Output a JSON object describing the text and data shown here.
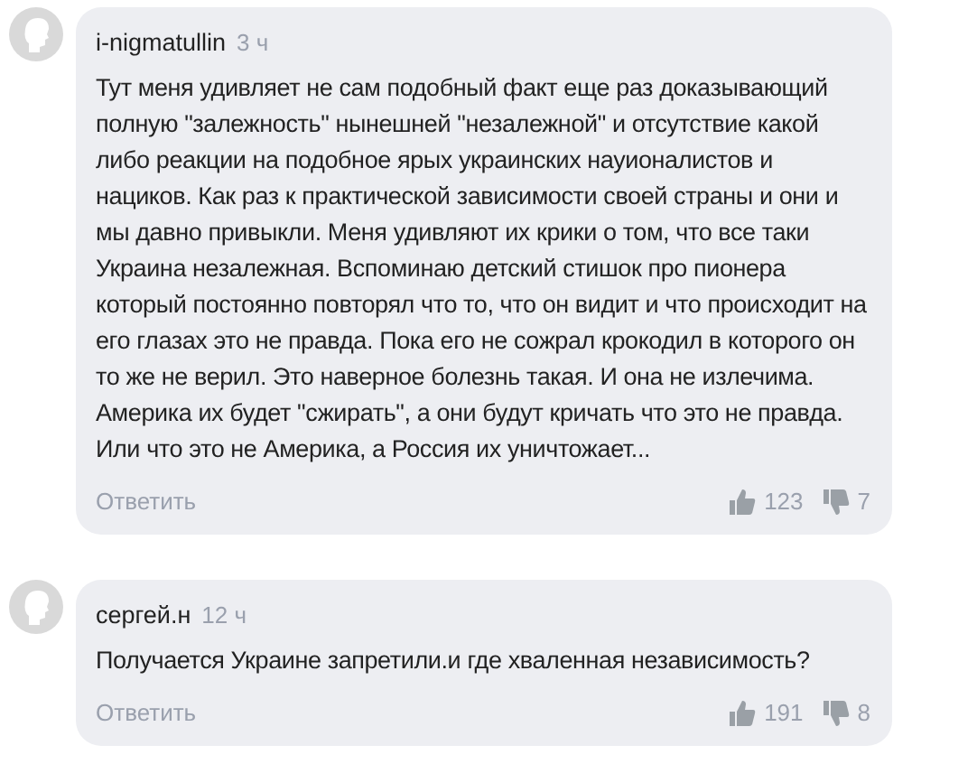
{
  "comments": [
    {
      "author": "i-nigmatullin",
      "time": "3 ч",
      "text": "Тут меня удивляет не сам подобный факт еще раз доказывающий полную \"залежность\" нынешней \"незалежной\" и отсутствие какой либо реакции на подобное ярых украинских науионалистов и нациков. Как раз к практической зависимости своей страны и они и мы давно привыкли. Меня удивляют их крики о том, что все таки Украина незалежная. Вспоминаю детский стишок про пионера который постоянно повторял что то, что он видит и что происходит на его глазах это не правда. Пока его не сожрал крокодил в которого он то же не верил. Это наверное болезнь такая. И она не излечима. Америка их будет \"сжирать\", а они будут кричать что это не правда. Или что это не Америка, а Россия их уничтожает...",
      "reply": "Ответить",
      "likes": "123",
      "dislikes": "7"
    },
    {
      "author": "сергей.н",
      "time": "12 ч",
      "text": "Получается Украине запретили.и где хваленная независимость?",
      "reply": "Ответить",
      "likes": "191",
      "dislikes": "8"
    }
  ]
}
